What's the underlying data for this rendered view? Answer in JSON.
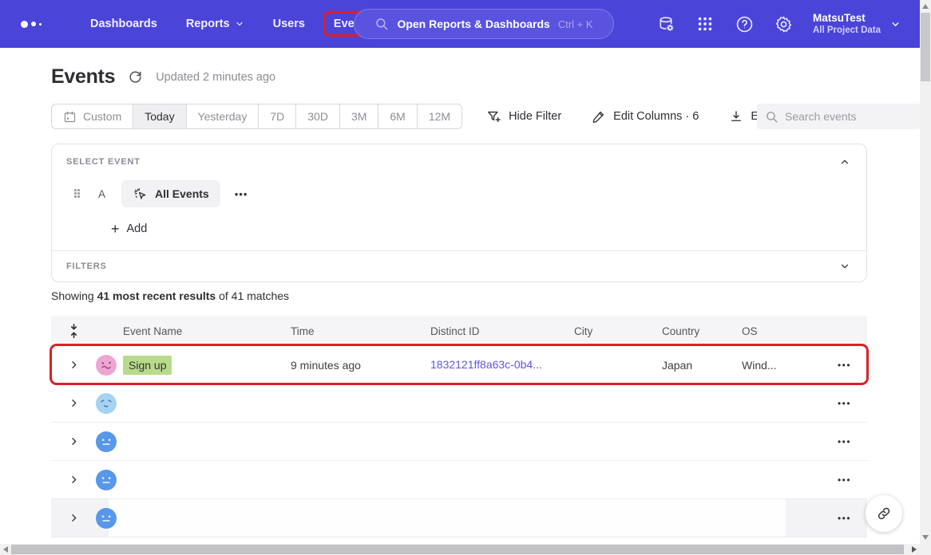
{
  "nav": {
    "items": [
      {
        "label": "Dashboards"
      },
      {
        "label": "Reports",
        "has_dropdown": true
      },
      {
        "label": "Users"
      },
      {
        "label": "Events",
        "annotated": true
      }
    ],
    "search_placeholder": "Open Reports & Dashboards",
    "search_shortcut": "Ctrl + K",
    "project_name": "MatsuTest",
    "project_subtitle": "All Project Data"
  },
  "page_header": {
    "title": "Events",
    "updated_text": "Updated 2 minutes ago"
  },
  "toolbar": {
    "date_ranges": [
      "Custom",
      "Today",
      "Yesterday",
      "7D",
      "30D",
      "3M",
      "6M",
      "12M"
    ],
    "selected_range": "Today",
    "hide_filter_label": "Hide Filter",
    "edit_columns_label": "Edit Columns · 6",
    "export_label": "Export",
    "search_placeholder": "Search events"
  },
  "query_builder": {
    "select_event_label": "SELECT EVENT",
    "event_row_letter": "A",
    "event_chip_label": "All Events",
    "add_label": "Add",
    "filters_label": "FILTERS"
  },
  "results_summary": {
    "prefix": "Showing ",
    "bold": "41 most recent results",
    "suffix": " of 41 matches"
  },
  "table": {
    "columns": [
      "Event Name",
      "Time",
      "Distinct ID",
      "City",
      "Country",
      "OS"
    ],
    "visible_row": {
      "event_name": "Sign up",
      "time": "9 minutes ago",
      "distinct_id": "1832121ff8a63c-0b4...",
      "city_redacted": true,
      "country": "Japan",
      "os": "Wind...",
      "highlighted": true
    },
    "redacted_row_count": 4
  },
  "icons": {
    "more_horizontal": "•••",
    "plus": "+",
    "help_glyph": "?"
  },
  "colors": {
    "navbar_bg": "#4b44d9",
    "annotation_red": "#dd1f26",
    "highlight_green": "#b7db8b",
    "link_purple": "#5f55e8",
    "avatar_pink": "#eba7d2",
    "avatar_blue_light": "#a5d3f2",
    "avatar_blue": "#5897ea"
  }
}
